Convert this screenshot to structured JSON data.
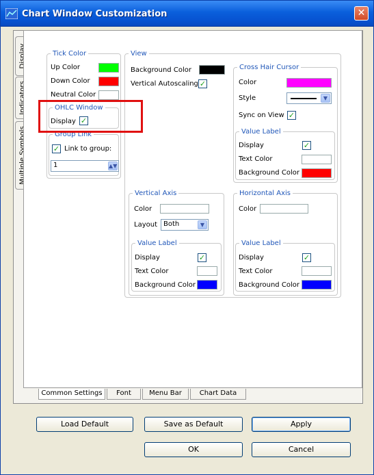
{
  "window": {
    "title": "Chart Window Customization",
    "close_symbol": "✕"
  },
  "side_tabs": [
    "Display",
    "Indicators",
    "Multiple Symbols"
  ],
  "bottom_tabs": [
    "Common Settings",
    "Font",
    "Menu Bar",
    "Chart Data"
  ],
  "tick_color": {
    "legend": "Tick Color",
    "up_label": "Up Color",
    "up_color": "#00ff00",
    "down_label": "Down Color",
    "down_color": "#ff0000",
    "neutral_label": "Neutral Color",
    "neutral_color": "#ffffff"
  },
  "ohlc_window": {
    "legend": "OHLC Window",
    "display_label": "Display",
    "display_checked": true
  },
  "group_link": {
    "legend": "Group Link",
    "link_label": "Link to group:",
    "link_checked": true,
    "group_value": "1"
  },
  "view": {
    "legend": "View",
    "background_label": "Background Color",
    "background_color": "#000000",
    "autoscale_label": "Vertical Autoscaling",
    "autoscale_checked": true
  },
  "cross_hair": {
    "legend": "Cross Hair Cursor",
    "color_label": "Color",
    "color": "#ff00ff",
    "style_label": "Style",
    "sync_label": "Sync on View",
    "sync_checked": true,
    "value_label": {
      "legend": "Value Label",
      "display_label": "Display",
      "display_checked": true,
      "text_label": "Text Color",
      "text_color": "#ffffff",
      "bg_label": "Background Color",
      "bg_color": "#ff0000"
    }
  },
  "vertical_axis": {
    "legend": "Vertical Axis",
    "color_label": "Color",
    "color": "#ffffff",
    "layout_label": "Layout",
    "layout_value": "Both",
    "value_label": {
      "legend": "Value Label",
      "display_label": "Display",
      "display_checked": true,
      "text_label": "Text Color",
      "text_color": "#ffffff",
      "bg_label": "Background Color",
      "bg_color": "#0000ff"
    }
  },
  "horizontal_axis": {
    "legend": "Horizontal Axis",
    "color_label": "Color",
    "color": "#ffffff",
    "value_label": {
      "legend": "Value Label",
      "display_label": "Display",
      "display_checked": true,
      "text_label": "Text Color",
      "text_color": "#ffffff",
      "bg_label": "Background Color",
      "bg_color": "#0000ff"
    }
  },
  "buttons": {
    "load_default": "Load Default",
    "save_default": "Save as Default",
    "apply": "Apply",
    "ok": "OK",
    "cancel": "Cancel"
  },
  "check_symbol": "✓"
}
